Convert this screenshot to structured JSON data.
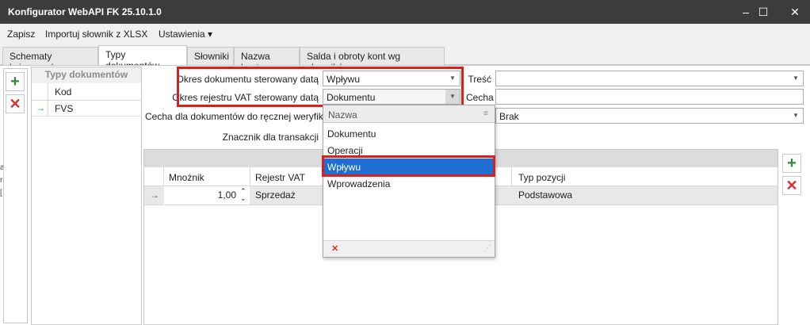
{
  "window": {
    "title": "Konfigurator WebAPI FK 25.10.1.0",
    "minimize_glyph": "–",
    "maximize_glyph": "☐",
    "close_glyph": "✕"
  },
  "menu": {
    "items": [
      "Zapisz",
      "Importuj słownik z XLSX",
      "Ustawienia ▾"
    ]
  },
  "tabs": [
    {
      "label": "Schematy księgowań"
    },
    {
      "label": "Typy dokumentów"
    },
    {
      "label": "Słowniki"
    },
    {
      "label": "Nazwa konta"
    },
    {
      "label": "Salda i obroty kont wg słowników"
    }
  ],
  "left_panel": {
    "add_icon": "+",
    "delete_icon": "✕"
  },
  "types_list": {
    "header": "Typy dokumentów",
    "column": "Kod",
    "rows": [
      {
        "marker": "→",
        "kod": "FVS"
      }
    ]
  },
  "form": {
    "okres_dokumentu_label": "Okres dokumentu sterowany datą",
    "okres_dokumentu_value": "Wpływu",
    "okres_vat_label": "Okres rejestru VAT sterowany datą",
    "okres_vat_value": "Dokumentu",
    "tresc_label": "Treść",
    "tresc_value": "",
    "cecha_label": "Cecha",
    "cecha_value": "",
    "cecha_reczna_label": "Cecha dla dokumentów do ręcznej weryfikacji",
    "cecha_reczna_value": "Brak",
    "znacznik_label": "Znacznik dla transakcji"
  },
  "dropdown": {
    "header": "Nazwa",
    "options": [
      "Dokumentu",
      "Operacji",
      "Wpływu",
      "Wprowadzenia"
    ],
    "selected": "Wpływu",
    "clear_icon": "✕",
    "resize_glyph": "⋰"
  },
  "grid": {
    "columns": [
      "Mnożnik",
      "Rejestr VAT",
      "Typ pozycji"
    ],
    "rows": [
      {
        "marker": "→",
        "mnoznik": "1,00",
        "spin": "⌃⌄",
        "rejestr": "Sprzedaż",
        "typ": "Podstawowa"
      }
    ]
  },
  "right_panel": {
    "add_icon": "+",
    "delete_icon": "✕"
  },
  "left_edge_glyphs": [
    "a",
    "r",
    "["
  ],
  "colors": {
    "highlight_border": "#d8211c",
    "selection": "#1e6fd1",
    "titlebar": "#3c3c3c",
    "add_green": "#2e8b3e",
    "delete_red": "#d8322d"
  }
}
